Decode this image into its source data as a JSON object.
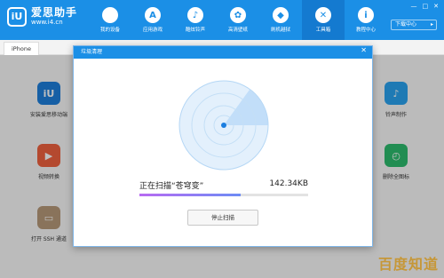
{
  "app": {
    "logo_badge": "iU",
    "name": "爱思助手",
    "url": "www.i4.cn"
  },
  "nav": [
    {
      "label": "我的设备",
      "icon": "apple-icon",
      "glyph": ""
    },
    {
      "label": "应用游戏",
      "icon": "appstore-icon",
      "glyph": "A"
    },
    {
      "label": "酷炫铃声",
      "icon": "bell-icon",
      "glyph": "♪"
    },
    {
      "label": "高清壁纸",
      "icon": "wallpaper-icon",
      "glyph": "✿"
    },
    {
      "label": "刷机越狱",
      "icon": "box-icon",
      "glyph": "◆"
    },
    {
      "label": "工具箱",
      "icon": "tools-icon",
      "glyph": "✕"
    },
    {
      "label": "教程中心",
      "icon": "info-icon",
      "glyph": "i"
    }
  ],
  "header": {
    "download_label": "下载中心",
    "download_arrow": "▸"
  },
  "window_controls": [
    "—",
    "□",
    "✕"
  ],
  "tab": {
    "label": "iPhone"
  },
  "tools_left": [
    {
      "label": "安装爱思移动端",
      "icon": "i4-mobile-icon",
      "glyph": "iU",
      "color": "#1e7fdc"
    },
    {
      "label": "视频转换",
      "icon": "video-convert-icon",
      "glyph": "▶",
      "color": "#f0623f"
    },
    {
      "label": "打开 SSH 通道",
      "icon": "ssh-terminal-icon",
      "glyph": "▭",
      "color": "#b79a7a"
    }
  ],
  "tools_right": [
    {
      "label": "铃声制作",
      "icon": "ringtone-bell-icon",
      "glyph": "♪",
      "color": "#2aa3f0"
    },
    {
      "label": "删除全图标",
      "icon": "clock-icon",
      "glyph": "◴",
      "color": "#2dbd6e"
    }
  ],
  "dialog": {
    "title": "垃圾清理",
    "close_label": "✕",
    "scan_text": "正在扫描“苍穹变”",
    "scan_size": "142.34KB",
    "progress": 0.6,
    "stop_label": "停止扫描"
  },
  "watermark": "百度知道",
  "colors": {
    "primary": "#1b8fe6",
    "radar_light": "#dcecfb",
    "radar_ring": "#9cc9f2",
    "radar_dot": "#1b7ee0",
    "progress_start": "#b86bf2",
    "progress_end": "#6d8cf5"
  }
}
